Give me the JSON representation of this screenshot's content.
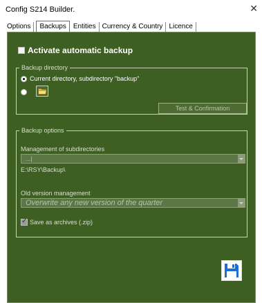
{
  "window": {
    "title": "Config S214 Builder."
  },
  "tabs": [
    {
      "label": "Options"
    },
    {
      "label": "Backups"
    },
    {
      "label": "Entities"
    },
    {
      "label": "Currency & Country"
    },
    {
      "label": "Licence"
    }
  ],
  "backup": {
    "activate_label": "Activate automatic backup",
    "activate_checked": false,
    "directory": {
      "legend": "Backup directory",
      "option_current_label": "Current directory, subdirectory \"backup\"",
      "test_button_label": "Test & Confirmation"
    },
    "options": {
      "legend": "Backup options",
      "subdir_label": "Management of subdirectories",
      "subdir_value": "...|",
      "path_value": "E:\\RSY\\Backup\\",
      "version_label": "Old version management",
      "version_value": "Overwrite any new version of the quarter",
      "archive_label": "Save as archives (.zip)",
      "archive_checked": true
    }
  },
  "colors": {
    "panel_bg": "#3e5f22",
    "save_icon": "#1c6ed1"
  },
  "icons": {
    "close": "close-icon",
    "folder": "folder-icon",
    "save": "floppy-disk-icon"
  }
}
